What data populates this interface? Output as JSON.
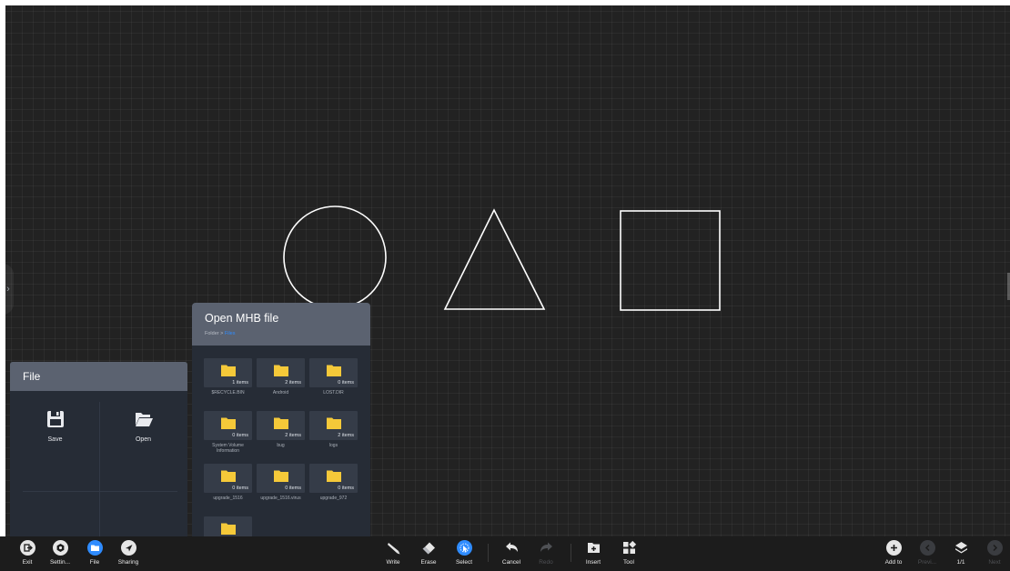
{
  "colors": {
    "canvas_bg": "#222222",
    "panel_bg": "#262c36",
    "panel_header": "#5b6270",
    "folder_yellow": "#f4c93a",
    "accent_blue": "#2f8cff",
    "stroke": "#ffffff"
  },
  "file_panel": {
    "title": "File",
    "actions": [
      {
        "label": "Save",
        "icon": "floppy-disk-icon"
      },
      {
        "label": "Open",
        "icon": "open-folder-icon"
      }
    ]
  },
  "open_dialog": {
    "title": "Open MHB file",
    "breadcrumb_root": "Folder",
    "breadcrumb_separator": ">",
    "breadcrumb_current": "Files",
    "folders": [
      {
        "count": "1 items",
        "name": "$RECYCLE.BIN"
      },
      {
        "count": "2 items",
        "name": "Android"
      },
      {
        "count": "0 items",
        "name": "LOST.DIR"
      },
      {
        "count": "0 items",
        "name": "System Volume Information"
      },
      {
        "count": "2 items",
        "name": "bug"
      },
      {
        "count": "2 items",
        "name": "logs"
      },
      {
        "count": "0 items",
        "name": "upgrade_1516"
      },
      {
        "count": "0 items",
        "name": "upgrade_1516.virus"
      },
      {
        "count": "0 items",
        "name": "upgrade_972"
      },
      {
        "count": "",
        "name": ""
      }
    ]
  },
  "toolbar": {
    "exit": "Exit",
    "settings": "Settin...",
    "file": "File",
    "sharing": "Sharing",
    "write": "Write",
    "erase": "Erase",
    "select": "Select",
    "cancel": "Cancel",
    "redo": "Redo",
    "insert": "Insert",
    "tool": "Tool",
    "add_to": "Add to",
    "previous": "Previ...",
    "page_indicator": "1/1",
    "next": "Next"
  }
}
